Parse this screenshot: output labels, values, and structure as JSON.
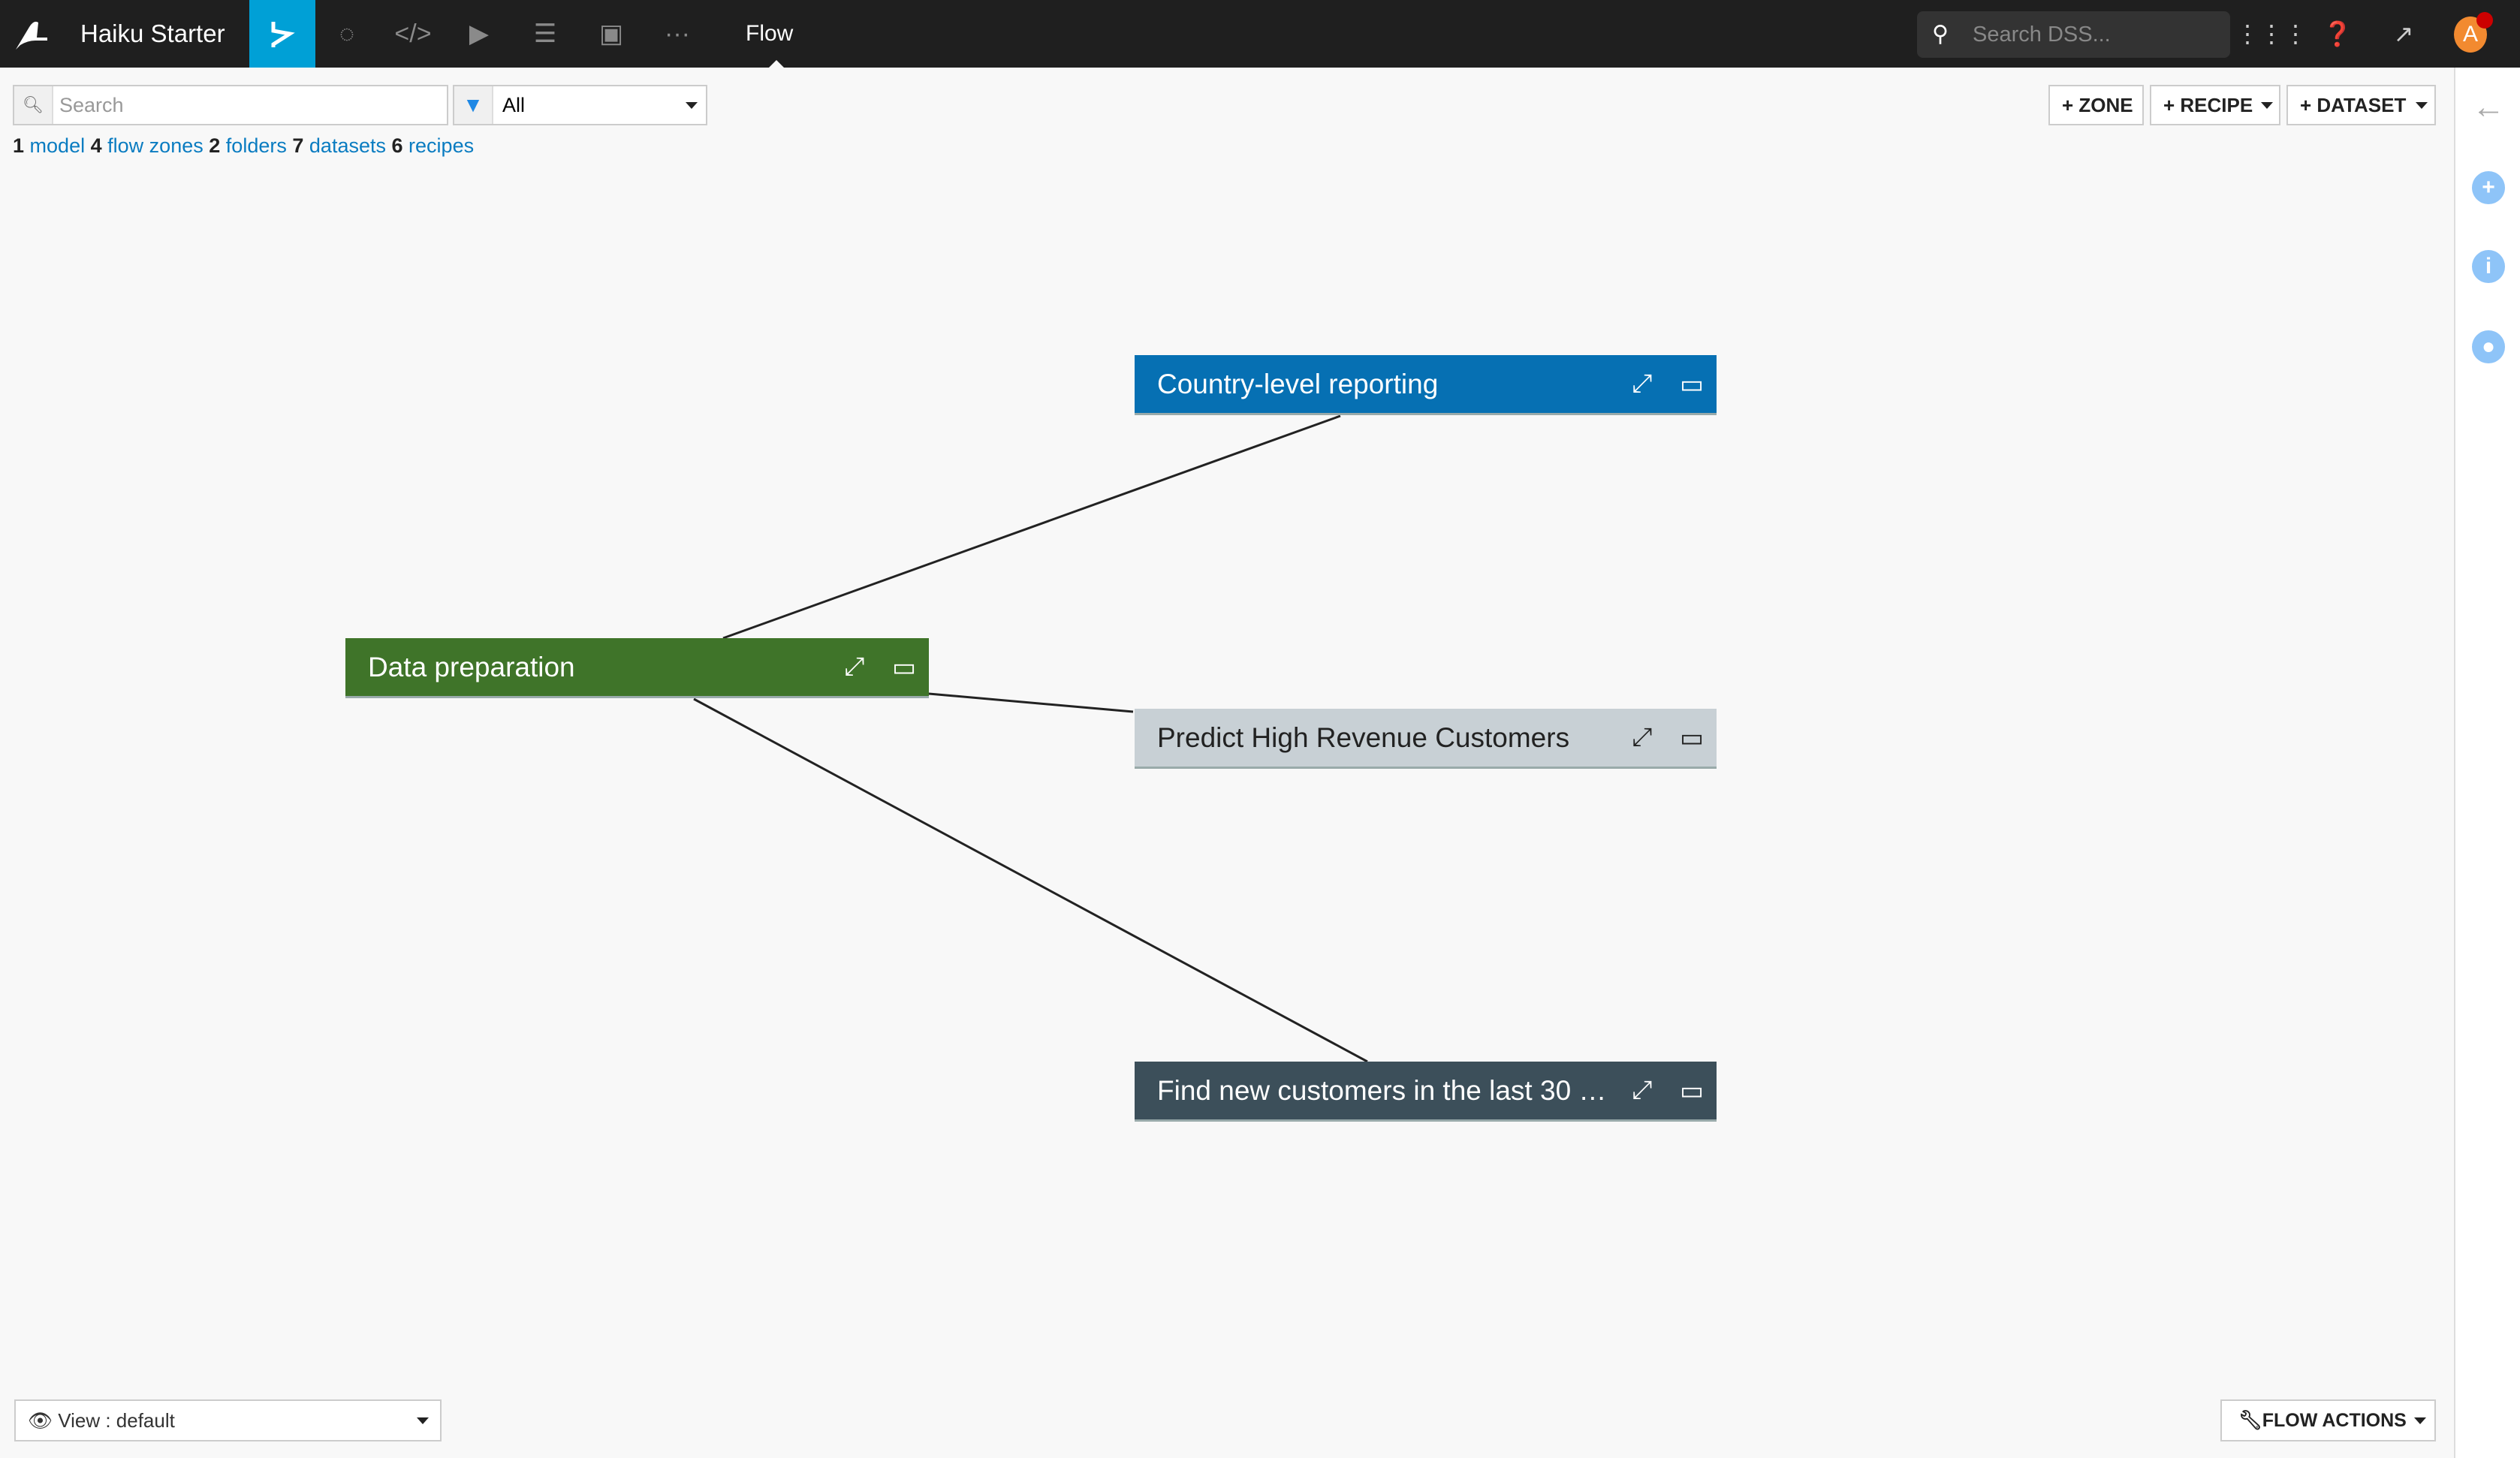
{
  "topbar": {
    "project_name": "Haiku Starter",
    "current_section": "Flow",
    "search_placeholder": "Search DSS...",
    "avatar_letter": "A",
    "nav_icons": [
      "flow-icon",
      "lab-icon",
      "code-icon",
      "run-icon",
      "notebook-stack-icon",
      "dashboard-icon",
      "more-icon"
    ]
  },
  "toolbar": {
    "search_placeholder": "Search",
    "filter_value": "All",
    "zone_label": "+ ZONE",
    "recipe_label": "+ RECIPE",
    "dataset_label": "+ DATASET"
  },
  "stats": [
    {
      "count": "1",
      "label": "model"
    },
    {
      "count": "4",
      "label": "flow zones"
    },
    {
      "count": "2",
      "label": "folders"
    },
    {
      "count": "7",
      "label": "datasets"
    },
    {
      "count": "6",
      "label": "recipes"
    }
  ],
  "zones": [
    {
      "name": "Country-level reporting",
      "color": "#0670b3",
      "text_color": "#ffffff"
    },
    {
      "name": "Data preparation",
      "color": "#3f7429",
      "text_color": "#ffffff"
    },
    {
      "name": "Predict High Revenue Customers",
      "color": "#c8d0d5",
      "text_color": "#222222"
    },
    {
      "name": "Find new customers in the last 30 …",
      "color": "#3c4f5a",
      "text_color": "#ffffff"
    }
  ],
  "links": [
    [
      "Data preparation",
      "Country-level reporting"
    ],
    [
      "Data preparation",
      "Predict High Revenue Customers"
    ],
    [
      "Data preparation",
      "Find new customers in the last 30 …"
    ]
  ],
  "bottom": {
    "view_label": "View : default",
    "flow_actions_label": "FLOW ACTIONS"
  },
  "colors": {
    "accent": "#00a0d6",
    "link": "#0a7cc1",
    "topbar": "#1f1f1f"
  }
}
